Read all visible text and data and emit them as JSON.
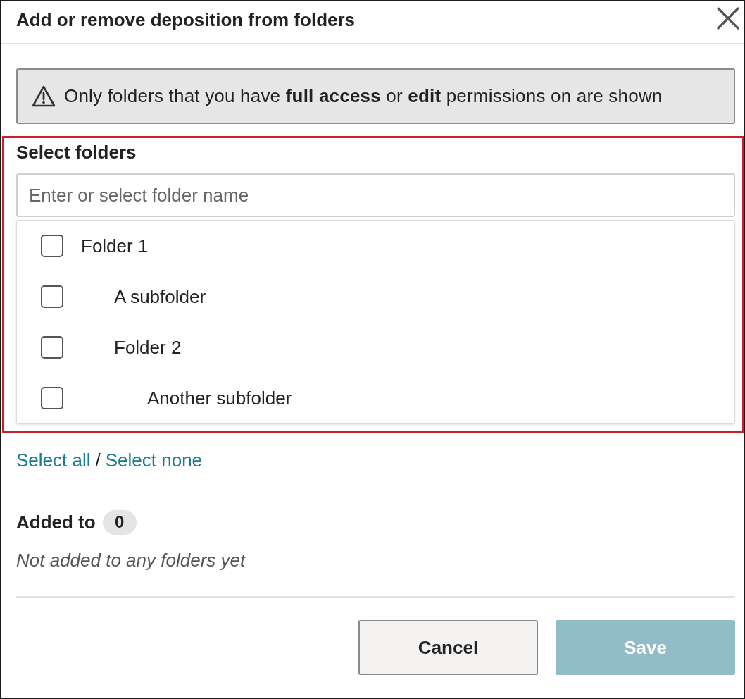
{
  "dialog": {
    "title": "Add or remove deposition from folders"
  },
  "notice": {
    "text": "Only folders that you have **full access** or **edit** permissions on are shown"
  },
  "folder_select": {
    "highlighted": true,
    "label": "Select folders",
    "placeholder": "Enter or select folder name",
    "folders": [
      {
        "name": "Folder 1",
        "checked": false,
        "children": [
          {
            "name": "A subfolder",
            "checked": false
          },
          {
            "name": "Folder 2",
            "checked": false,
            "children": [
              {
                "name": "Another subfolder",
                "checked": false
              }
            ]
          }
        ]
      }
    ]
  },
  "selection_links": {
    "all": "Select all",
    "separator": "/",
    "none": "Select none"
  },
  "added": {
    "label": "Added to",
    "count": "0",
    "empty_message": "Not added to any folders yet"
  },
  "buttons": [
    {
      "label": "Cancel",
      "kind": "secondary",
      "disabled": false
    },
    {
      "label": "Save",
      "kind": "primary",
      "disabled": true
    }
  ]
}
